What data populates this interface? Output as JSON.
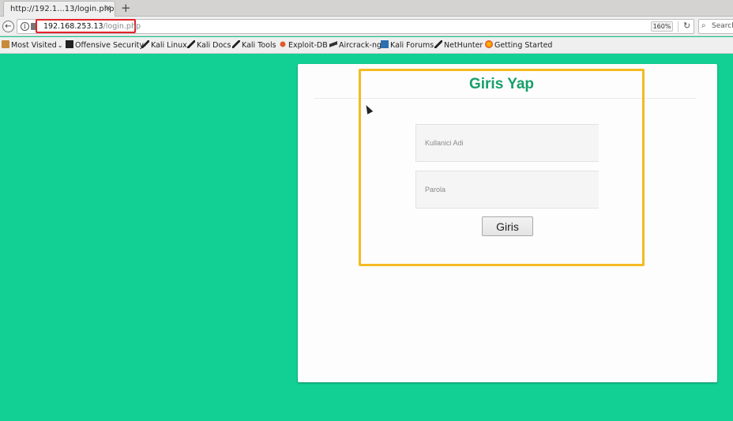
{
  "browser": {
    "tab_title": "http://192.1...13/login.php",
    "tab_close": "×",
    "new_tab": "+",
    "back": "←",
    "info": "i",
    "url_host": "192.168.253.13",
    "url_path": "/login.php",
    "zoom": "160%",
    "reload": "↻",
    "search_placeholder": "Search",
    "search_icon": "⌕",
    "url_highlight_color": "#e3242b"
  },
  "bookmarks": [
    {
      "label": "Most Visited",
      "icon": "folder-icon",
      "dropdown": "⌄"
    },
    {
      "label": "Offensive Security",
      "icon": "offsec-icon"
    },
    {
      "label": "Kali Linux",
      "icon": "kali-icon"
    },
    {
      "label": "Kali Docs",
      "icon": "kali-icon"
    },
    {
      "label": "Kali Tools",
      "icon": "kali-icon"
    },
    {
      "label": "Exploit-DB",
      "icon": "exploit-db-icon"
    },
    {
      "label": "Aircrack-ng",
      "icon": "aircrack-icon"
    },
    {
      "label": "Kali Forums",
      "icon": "forums-icon"
    },
    {
      "label": "NetHunter",
      "icon": "kali-icon"
    },
    {
      "label": "Getting Started",
      "icon": "firefox-icon"
    }
  ],
  "page": {
    "background": "#12cf93",
    "highlight_color": "#f4bb22",
    "login": {
      "title": "Giris Yap",
      "username_placeholder": "Kullanici Adi",
      "password_placeholder": "Parola",
      "submit_label": "Giris"
    }
  }
}
